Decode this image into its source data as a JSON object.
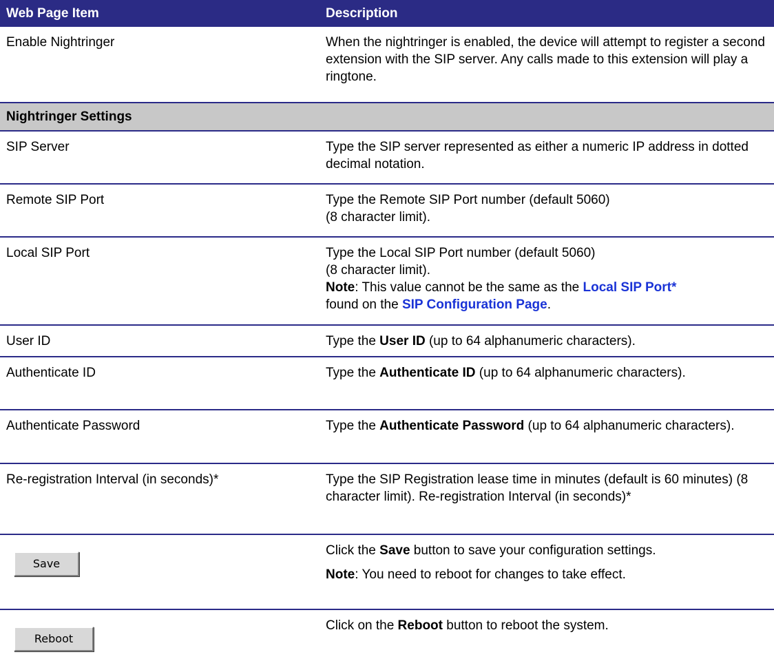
{
  "header": {
    "col1": "Web Page Item",
    "col2": "Description"
  },
  "rows": {
    "enable": {
      "item": "Enable Nightringer",
      "desc": "When the nightringer is enabled, the device will attempt to register a second extension with the SIP server. Any calls made to this extension will play a ringtone."
    },
    "section": "Nightringer Settings",
    "sip_server": {
      "item": "SIP Server",
      "desc": "Type the SIP server represented as either a numeric IP address in dotted decimal notation."
    },
    "remote_port": {
      "item": "Remote SIP Port",
      "desc_line1": "Type the Remote SIP Port number (default 5060)",
      "desc_line2": "(8 character limit)."
    },
    "local_port": {
      "item": "Local SIP Port",
      "desc_line1": "Type the Local SIP Port number (default 5060)",
      "desc_line2": "(8 character limit).",
      "note_label": "Note",
      "note_text": ": This value cannot be the same as the ",
      "note_link1": "Local SIP Port*",
      "note_text2": "found on the ",
      "note_link2": "SIP Configuration Page",
      "note_end": "."
    },
    "user_id": {
      "item": "User ID",
      "desc_pre": "Type the ",
      "desc_bold": "User ID",
      "desc_post": " (up to 64 alphanumeric characters)."
    },
    "auth_id": {
      "item": "Authenticate ID",
      "desc_pre": "Type the ",
      "desc_bold": "Authenticate ID",
      "desc_post": " (up to 64 alphanumeric characters)."
    },
    "auth_pw": {
      "item": "Authenticate Password",
      "desc_pre": "Type the ",
      "desc_bold": "Authenticate Password",
      "desc_post": " (up to 64 alphanumeric characters)."
    },
    "rereg": {
      "item": "Re-registration Interval (in seconds)*",
      "desc": "Type the SIP Registration lease time in minutes (default is 60 minutes) (8 character limit). Re-registration Interval (in seconds)*"
    },
    "save": {
      "button": "Save",
      "desc_pre": "Click the ",
      "desc_bold": "Save",
      "desc_post": " button to save your configuration settings.",
      "note_label": "Note",
      "note_text": ": You need to reboot for changes to take effect."
    },
    "reboot": {
      "button": "Reboot",
      "desc_pre": "Click on the ",
      "desc_bold": "Reboot",
      "desc_post": " button to reboot the system."
    }
  }
}
